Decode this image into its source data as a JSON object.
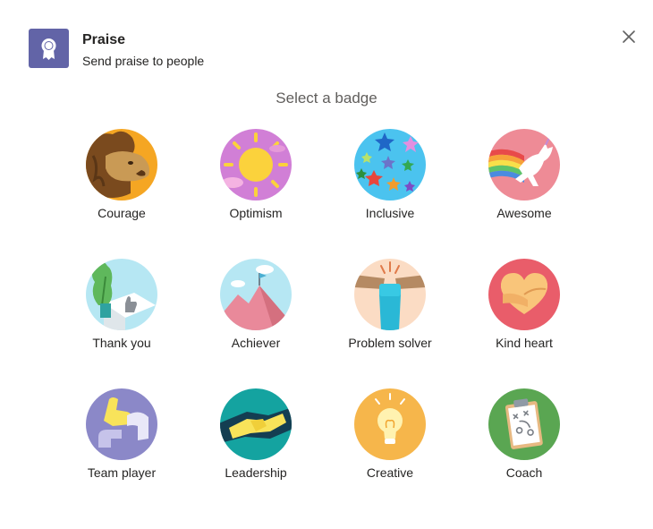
{
  "header": {
    "title": "Praise",
    "subtitle": "Send praise to people",
    "app_icon": "ribbon-icon",
    "close_icon": "close-icon",
    "brand_color": "#6264a7"
  },
  "heading": "Select a badge",
  "badges": [
    {
      "label": "Courage",
      "icon": "lion-icon",
      "color": "#f5a623"
    },
    {
      "label": "Optimism",
      "icon": "sun-icon",
      "color": "#d17fd6"
    },
    {
      "label": "Inclusive",
      "icon": "stars-icon",
      "color": "#4bc3ef"
    },
    {
      "label": "Awesome",
      "icon": "unicorn-icon",
      "color": "#ee8b96"
    },
    {
      "label": "Thank you",
      "icon": "thumbs-up-icon",
      "color": "#b6e7f3"
    },
    {
      "label": "Achiever",
      "icon": "mountain-icon",
      "color": "#b6e7f3"
    },
    {
      "label": "Problem solver",
      "icon": "fist-icon",
      "color": "#fbdcc4"
    },
    {
      "label": "Kind heart",
      "icon": "heart-hands-icon",
      "color": "#e95d6a"
    },
    {
      "label": "Team player",
      "icon": "linked-arms-icon",
      "color": "#8b88c8"
    },
    {
      "label": "Leadership",
      "icon": "handshake-icon",
      "color": "#14a3a0"
    },
    {
      "label": "Creative",
      "icon": "lightbulb-icon",
      "color": "#f6b64b"
    },
    {
      "label": "Coach",
      "icon": "clipboard-icon",
      "color": "#5aa652"
    }
  ]
}
